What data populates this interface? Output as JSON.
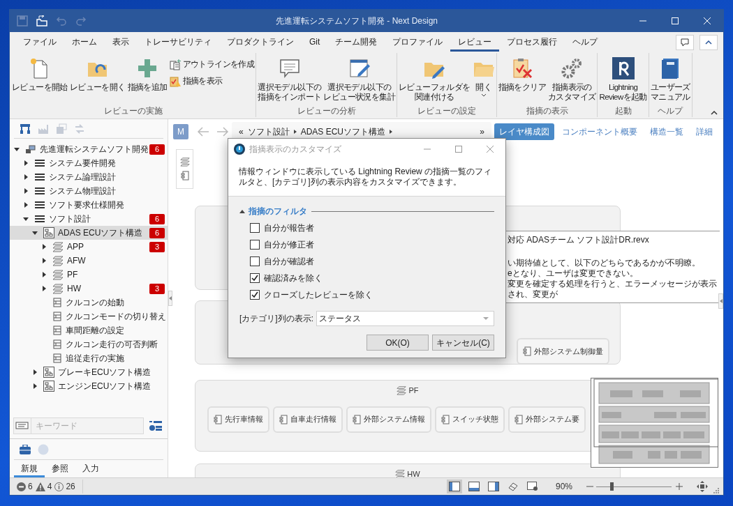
{
  "window": {
    "title": "先進運転システムソフト開発 - Next Design"
  },
  "quick_access": [
    {
      "disabled": true
    },
    {
      "disabled": false
    },
    {
      "disabled": true
    },
    {
      "disabled": true
    }
  ],
  "ribbon_tabs": [
    {
      "label": "ファイル",
      "selected": false
    },
    {
      "label": "ホーム",
      "selected": false
    },
    {
      "label": "表示",
      "selected": false
    },
    {
      "label": "トレーサビリティ",
      "selected": false
    },
    {
      "label": "プロダクトライン",
      "selected": false
    },
    {
      "label": "Git",
      "selected": false
    },
    {
      "label": "チーム開発",
      "selected": false
    },
    {
      "label": "プロファイル",
      "selected": false
    },
    {
      "label": "レビュー",
      "selected": true
    },
    {
      "label": "プロセス履行",
      "selected": false
    },
    {
      "label": "ヘルプ",
      "selected": false
    }
  ],
  "ribbon_groups": [
    {
      "label": "レビューの実施",
      "buttons": [
        {
          "kind": "large",
          "lines": [
            "レビューを開始"
          ]
        },
        {
          "kind": "large",
          "lines": [
            "レビューを開く"
          ]
        },
        {
          "kind": "large",
          "lines": [
            "指摘を追加"
          ]
        },
        {
          "kind": "small",
          "lines": [
            "アウトラインを作成"
          ]
        },
        {
          "kind": "small",
          "lines": [
            "指摘を表示"
          ]
        }
      ]
    },
    {
      "label": "レビューの分析",
      "buttons": [
        {
          "kind": "large",
          "lines": [
            "選択モデル以下の",
            "指摘をインポート"
          ]
        },
        {
          "kind": "large",
          "lines": [
            "選択モデル以下の",
            "レビュー状況を集計"
          ]
        }
      ]
    },
    {
      "label": "レビューの設定",
      "buttons": [
        {
          "kind": "large",
          "lines": [
            "レビューフォルダを",
            "関連付ける"
          ]
        },
        {
          "kind": "dropdown",
          "lines": [
            "開く"
          ]
        }
      ]
    },
    {
      "label": "指摘の表示",
      "buttons": [
        {
          "kind": "large",
          "lines": [
            "指摘をクリア"
          ]
        },
        {
          "kind": "large",
          "lines": [
            "指摘表示の",
            "カスタマイズ"
          ]
        }
      ]
    },
    {
      "label": "起動",
      "buttons": [
        {
          "kind": "large",
          "lines": [
            "Lightning",
            "Reviewを起動"
          ]
        }
      ]
    },
    {
      "label": "ヘルプ",
      "buttons": [
        {
          "kind": "large",
          "lines": [
            "ユーザーズ",
            "マニュアル"
          ]
        }
      ]
    }
  ],
  "panel_tools": [
    {
      "disabled": false
    },
    {
      "disabled": true
    },
    {
      "disabled": true
    },
    {
      "disabled": true
    }
  ],
  "tree": [
    {
      "kind": "project",
      "label": "先進運転システムソフト開発",
      "badge": "6",
      "expanded": true,
      "selected": false,
      "children": [
        {
          "kind": "list",
          "label": "システム要件開発",
          "expanded": false,
          "selected": false
        },
        {
          "kind": "list",
          "label": "システム論理設計",
          "expanded": false,
          "selected": false
        },
        {
          "kind": "list",
          "label": "システム物理設計",
          "expanded": false,
          "selected": false
        },
        {
          "kind": "list",
          "label": "ソフト要求仕様開発",
          "expanded": false,
          "selected": false
        },
        {
          "kind": "list",
          "label": "ソフト設計",
          "badge": "6",
          "expanded": true,
          "selected": false,
          "children": [
            {
              "kind": "structure",
              "label": "ADAS ECUソフト構造",
              "badge": "6",
              "expanded": true,
              "selected": true,
              "children": [
                {
                  "kind": "layer",
                  "label": "APP",
                  "badge": "3",
                  "expanded": false,
                  "selected": false
                },
                {
                  "kind": "layer",
                  "label": "AFW",
                  "expanded": false,
                  "selected": false
                },
                {
                  "kind": "layer",
                  "label": "PF",
                  "expanded": false,
                  "selected": false
                },
                {
                  "kind": "layer",
                  "label": "HW",
                  "badge": "3",
                  "expanded": false,
                  "selected": false
                },
                {
                  "kind": "feature",
                  "label": "クルコンの始動",
                  "selected": false
                },
                {
                  "kind": "feature",
                  "label": "クルコンモードの切り替え",
                  "selected": false
                },
                {
                  "kind": "feature",
                  "label": "車間距離の設定",
                  "selected": false
                },
                {
                  "kind": "feature",
                  "label": "クルコン走行の可否判断",
                  "selected": false
                },
                {
                  "kind": "feature",
                  "label": "追従走行の実施",
                  "selected": false
                }
              ]
            },
            {
              "kind": "structure",
              "label": "ブレーキECUソフト構造",
              "expanded": false,
              "selected": false
            },
            {
              "kind": "structure",
              "label": "エンジンECUソフト構造",
              "expanded": false,
              "selected": false
            }
          ]
        }
      ]
    }
  ],
  "search": {
    "placeholder": "キーワード"
  },
  "bottom_tabs": [
    {
      "label": "新規",
      "selected": true
    },
    {
      "label": "参照",
      "selected": false
    },
    {
      "label": "入力",
      "selected": false
    }
  ],
  "nav": {
    "model_badge": "M",
    "scroll_left": "«",
    "breadcrumb": [
      "ソフト設計",
      "ADAS ECUソフト構造"
    ],
    "scroll_right": "»"
  },
  "view_tabs": [
    {
      "label": "レイヤ構成図",
      "selected": true
    },
    {
      "label": "コンポーネント概要",
      "selected": false
    },
    {
      "label": "構造一覧",
      "selected": false
    },
    {
      "label": "詳細",
      "selected": false
    }
  ],
  "layers": [
    {
      "nodes": [
        {
          "label": "外部システム制御量"
        }
      ]
    },
    {
      "label": "PF",
      "nodes": [
        {
          "label": "先行車情報"
        },
        {
          "label": "自車走行情報"
        },
        {
          "label": "外部システム情報"
        },
        {
          "label": "スイッチ状態"
        },
        {
          "label": "外部システム要"
        }
      ]
    },
    {
      "label": "HW"
    }
  ],
  "info_panel": {
    "title": "対応 ADASチーム ソフト設計DR.revx",
    "lines": [
      "い期待値として、以下のどちらであるかが不明瞭。",
      "eとなり、ユーザは変更できない。",
      "変更を確定する処理を行うと、エラーメッセージが表示され、変更が"
    ]
  },
  "dialog": {
    "title": "指摘表示のカスタマイズ",
    "description": "情報ウィンドウに表示している Lightning Review の指摘一覧のフィルタと、[カテゴリ]列の表示内容をカスタマイズできます。",
    "filter_group": {
      "label": "指摘のフィルタ",
      "expanded": true,
      "options": [
        {
          "label": "自分が報告者",
          "checked": false
        },
        {
          "label": "自分が修正者",
          "checked": false
        },
        {
          "label": "自分が確認者",
          "checked": false
        },
        {
          "label": "確認済みを除く",
          "checked": true
        },
        {
          "label": "クローズしたレビューを除く",
          "checked": true
        }
      ]
    },
    "category_field": {
      "label": "[カテゴリ]列の表示:",
      "value": "ステータス"
    },
    "buttons": [
      "OK(O)",
      "キャンセル(C)"
    ]
  },
  "status": {
    "errors": "6",
    "warnings": "4",
    "infos": "26",
    "views": [
      {
        "selected": true
      },
      {
        "selected": false
      },
      {
        "selected": false
      },
      {
        "selected": false
      },
      {
        "selected": false
      }
    ],
    "zoom": "90%",
    "zoom_slider": {
      "level": 0.2
    }
  }
}
